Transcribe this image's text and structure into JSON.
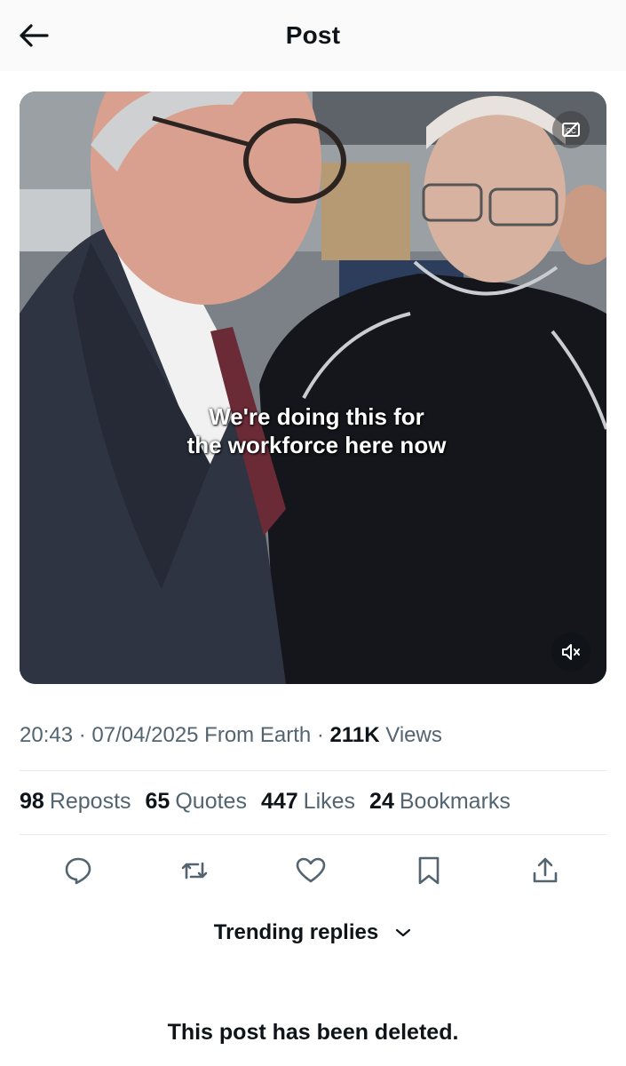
{
  "header": {
    "title": "Post",
    "back_icon": "arrow-left-icon"
  },
  "media": {
    "caption_line1": "We're doing this for",
    "caption_line2": "the workforce here now",
    "cc_icon": "captions-off-icon",
    "mute_icon": "muted-speaker-icon"
  },
  "meta": {
    "time": "20:43",
    "sep1": " · ",
    "date": "07/04/2025",
    "source": " From Earth",
    "sep2": " · ",
    "views_count": "211K",
    "views_label": " Views"
  },
  "stats": [
    {
      "count": "98",
      "label": "Reposts"
    },
    {
      "count": "65",
      "label": "Quotes"
    },
    {
      "count": "447",
      "label": "Likes"
    },
    {
      "count": "24",
      "label": "Bookmarks"
    }
  ],
  "actions": {
    "reply_icon": "reply-icon",
    "repost_icon": "repost-icon",
    "like_icon": "heart-icon",
    "bookmark_icon": "bookmark-icon",
    "share_icon": "share-icon"
  },
  "replies": {
    "sort_label": "Trending replies",
    "chevron_icon": "chevron-down-icon"
  },
  "notice": {
    "deleted_text": "This post has been deleted."
  },
  "colors": {
    "text": "#0f1419",
    "secondary": "#536471",
    "divider": "#e6e9eb"
  }
}
